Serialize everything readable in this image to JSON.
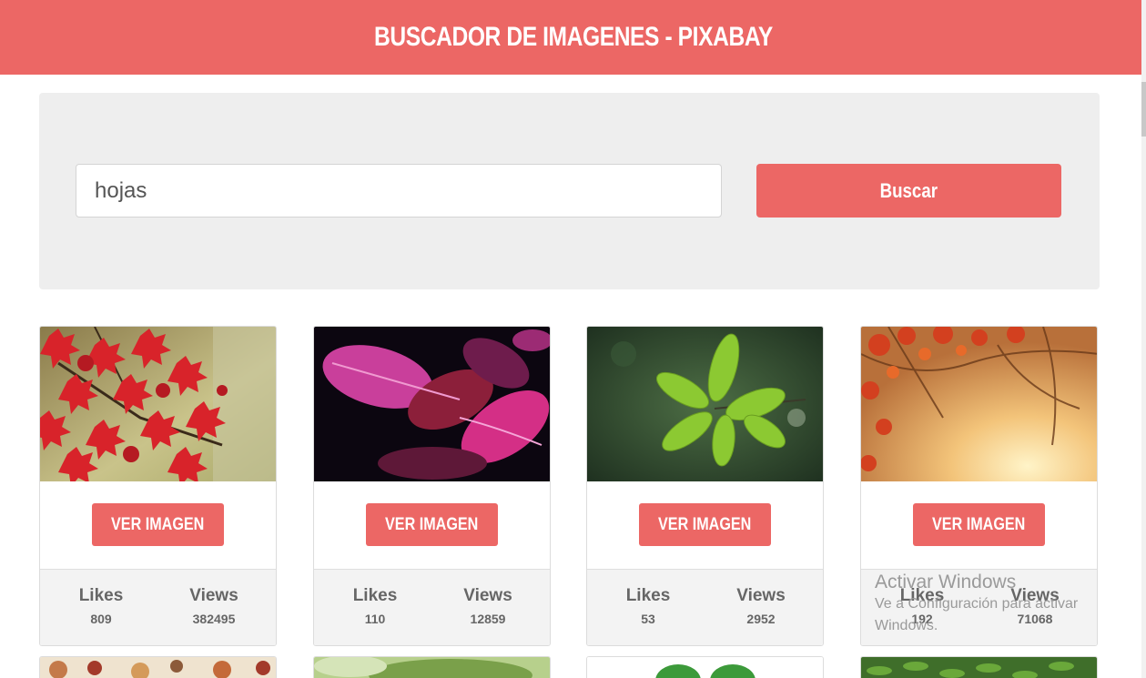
{
  "colors": {
    "accent": "#ec6765",
    "panel": "#eeeeee"
  },
  "header": {
    "title": "BUSCADOR DE IMAGENES - PIXABAY"
  },
  "search": {
    "value": "hojas",
    "button_label": "Buscar"
  },
  "cards": [
    {
      "button_label": "VER IMAGEN",
      "likes_label": "Likes",
      "likes": "809",
      "views_label": "Views",
      "views": "382495"
    },
    {
      "button_label": "VER IMAGEN",
      "likes_label": "Likes",
      "likes": "110",
      "views_label": "Views",
      "views": "12859"
    },
    {
      "button_label": "VER IMAGEN",
      "likes_label": "Likes",
      "likes": "53",
      "views_label": "Views",
      "views": "2952"
    },
    {
      "button_label": "VER IMAGEN",
      "likes_label": "Likes",
      "likes": "192",
      "views_label": "Views",
      "views": "71068"
    }
  ],
  "watermark": {
    "line1": "Activar Windows",
    "line2": "Ve a Configuración para activar Windows."
  }
}
